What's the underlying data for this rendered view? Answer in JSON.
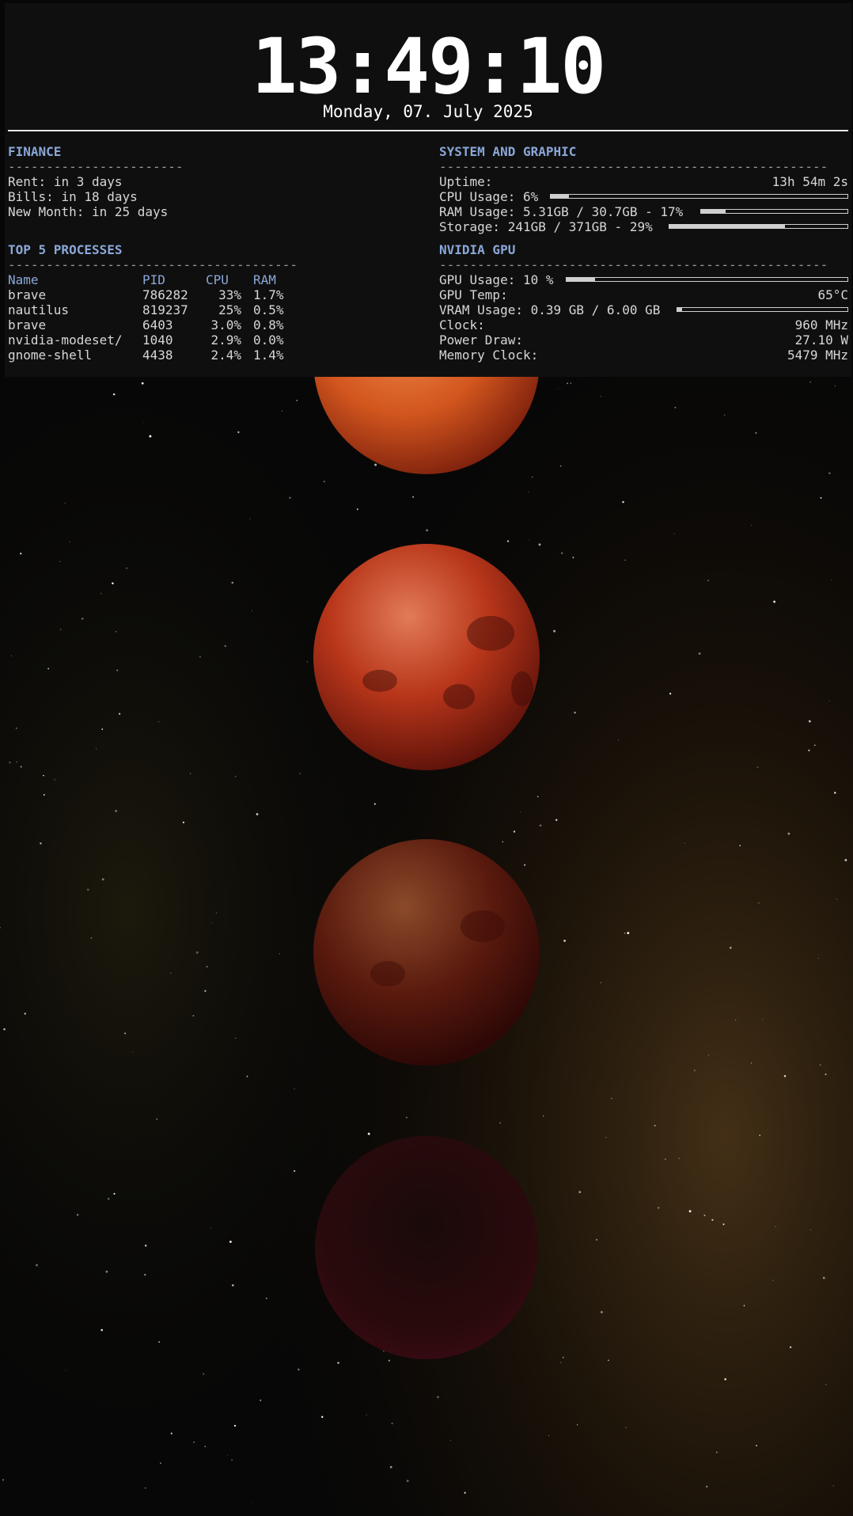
{
  "clock": {
    "time": "13:49:10",
    "date": "Monday, 07. July 2025"
  },
  "finance": {
    "title": "FINANCE",
    "dash": "-----------------------",
    "items": [
      {
        "label": "Rent:",
        "value": "in 3 days"
      },
      {
        "label": "Bills:",
        "value": "in 18 days"
      },
      {
        "label": "New Month:",
        "value": "in 25 days"
      }
    ]
  },
  "system": {
    "title": "SYSTEM AND GRAPHIC",
    "dash": "---------------------------------------------------",
    "uptime_label": "Uptime:",
    "uptime_value": "13h 54m 2s",
    "cpu_label": "CPU Usage: 6%",
    "cpu_fraction": 0.06,
    "ram_label": "RAM Usage: 5.31GB / 30.7GB - 17%",
    "ram_fraction": 0.17,
    "storage_label": "Storage: 241GB / 371GB - 29%",
    "storage_fraction": 0.65
  },
  "processes": {
    "title": "TOP 5 PROCESSES",
    "dash": "--------------------------------------",
    "columns": [
      "Name",
      "PID",
      "CPU",
      "RAM"
    ],
    "rows": [
      {
        "name": "brave",
        "pid": "786282",
        "cpu": "33%",
        "ram": "1.7%"
      },
      {
        "name": "nautilus",
        "pid": "819237",
        "cpu": "25%",
        "ram": "0.5%"
      },
      {
        "name": "brave",
        "pid": "6403",
        "cpu": "3.0%",
        "ram": "0.8%"
      },
      {
        "name": "nvidia-modeset/",
        "pid": "1040",
        "cpu": "2.9%",
        "ram": "0.0%"
      },
      {
        "name": "gnome-shell",
        "pid": "4438",
        "cpu": "2.4%",
        "ram": "1.4%"
      }
    ]
  },
  "gpu": {
    "title": "NVIDIA GPU",
    "dash": "---------------------------------------------------",
    "usage_label": "GPU Usage: 10 %",
    "usage_fraction": 0.1,
    "temp_label": "GPU Temp:",
    "temp_value": "65°C",
    "vram_label": "VRAM Usage: 0.39 GB / 6.00 GB",
    "vram_fraction": 0.03,
    "clock_label": "Clock:",
    "clock_value": "960 MHz",
    "power_label": "Power Draw:",
    "power_value": "27.10 W",
    "memclock_label": "Memory Clock:",
    "memclock_value": "5479 MHz"
  },
  "colors": {
    "accent": "#8aa7d8",
    "panel": "#0f0f0f",
    "text": "#d7d7d7",
    "moon": "#c2361a"
  }
}
